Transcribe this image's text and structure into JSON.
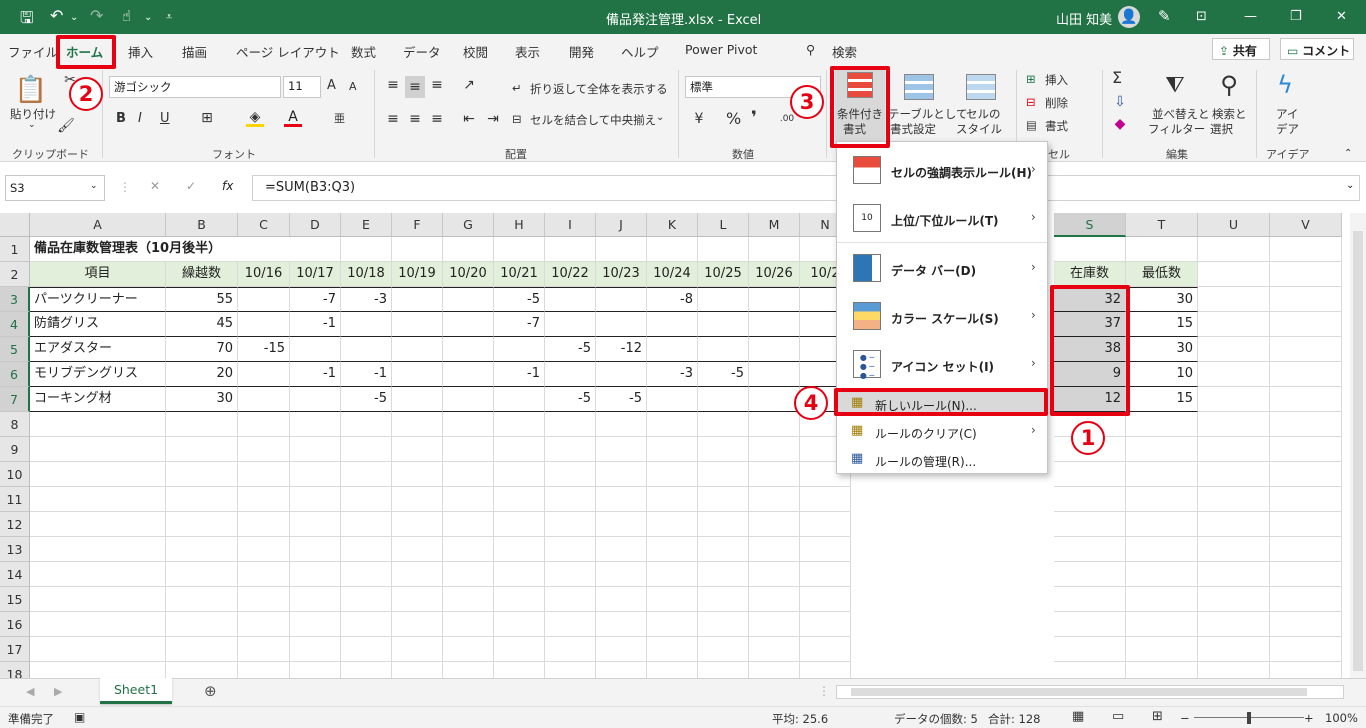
{
  "titlebar": {
    "title": "備品発注管理.xlsx - Excel",
    "user": "山田 知美",
    "qat_save_icon": "save-icon",
    "qat_undo_icon": "undo-icon",
    "qat_redo_icon": "redo-icon",
    "qat_touch_icon": "touch-mode-icon",
    "qat_customize_icon": "customize-qat-icon"
  },
  "tabs": [
    "ファイル",
    "ホーム",
    "挿入",
    "描画",
    "ページ レイアウト",
    "数式",
    "データ",
    "校閲",
    "表示",
    "開発",
    "ヘルプ",
    "Power Pivot"
  ],
  "search_label": "検索",
  "share_label": "共有",
  "comment_label": "コメント",
  "ribbon": {
    "paste_label": "貼り付け",
    "paste_sub": "⌄",
    "clipboard_group": "クリップボード",
    "font_name": "游ゴシック",
    "font_size": "11",
    "font_group": "フォント",
    "bold": "B",
    "italic": "I",
    "underline": "U",
    "font_grow": "A",
    "font_shrink": "A",
    "phonetic": "亜",
    "wrap_text": "折り返して全体を表示する",
    "merge_center": "セルを結合して中央揃え",
    "alignment_group": "配置",
    "number_format": "標準",
    "percent": "%",
    "comma": "❜",
    "number_group": "数値",
    "cond_format_l1": "条件付き",
    "cond_format_l2": "書式",
    "table_format_l1": "テーブルとして",
    "table_format_l2": "書式設定",
    "cell_style_l1": "セルの",
    "cell_style_l2": "スタイル",
    "insert": "挿入",
    "delete": "削除",
    "format": "書式",
    "cells_group": "セル",
    "sum_symbol": "Σ",
    "sort_filter_l1": "並べ替えと",
    "sort_filter_l2": "フィルター",
    "find_select_l1": "検索と",
    "find_select_l2": "選択",
    "editing_group": "編集",
    "ideas_l1": "アイ",
    "ideas_l2": "デア",
    "ideas_group": "アイデア"
  },
  "formula_bar": {
    "name_box": "S3",
    "cancel": "✕",
    "enter": "✓",
    "fx": "fx",
    "formula": "=SUM(B3:Q3)"
  },
  "columns": [
    "A",
    "B",
    "C",
    "D",
    "E",
    "F",
    "G",
    "H",
    "I",
    "J",
    "K",
    "L",
    "M",
    "N",
    "S",
    "T",
    "U",
    "V"
  ],
  "rows": [
    "1",
    "2",
    "3",
    "4",
    "5",
    "6",
    "7",
    "8",
    "9",
    "10",
    "11",
    "12",
    "13",
    "14",
    "15",
    "16",
    "17",
    "18"
  ],
  "sheet": {
    "title": "備品在庫数管理表（10月後半）",
    "headers": {
      "item": "項目",
      "carry": "繰越数",
      "dates": [
        "10/16",
        "10/17",
        "10/18",
        "10/19",
        "10/20",
        "10/21",
        "10/22",
        "10/23",
        "10/24",
        "10/25",
        "10/26",
        "10/2"
      ],
      "stock": "在庫数",
      "min": "最低数"
    },
    "data": [
      {
        "item": "パーツクリーナー",
        "carry": "55",
        "vals": [
          "",
          "-7",
          "-3",
          "",
          "",
          "-5",
          "",
          "",
          "-8",
          "",
          "",
          ""
        ],
        "stock": "32",
        "min": "30"
      },
      {
        "item": "防錆グリス",
        "carry": "45",
        "vals": [
          "",
          "-1",
          "",
          "",
          "",
          "-7",
          "",
          "",
          "",
          "",
          "",
          ""
        ],
        "stock": "37",
        "min": "15"
      },
      {
        "item": "エアダスター",
        "carry": "70",
        "vals": [
          "-15",
          "",
          "",
          "",
          "",
          "",
          "-5",
          "-12",
          "",
          "",
          "",
          ""
        ],
        "stock": "38",
        "min": "30"
      },
      {
        "item": "モリブデングリス",
        "carry": "20",
        "vals": [
          "",
          "-1",
          "-1",
          "",
          "",
          "-1",
          "",
          "",
          "-3",
          "-5",
          "",
          ""
        ],
        "stock": "9",
        "min": "10"
      },
      {
        "item": "コーキング材",
        "carry": "30",
        "vals": [
          "",
          "",
          "-5",
          "",
          "",
          "",
          "-5",
          "-5",
          "",
          "",
          "",
          ""
        ],
        "stock": "12",
        "min": "15"
      }
    ]
  },
  "menu": {
    "items": [
      {
        "label": "セルの強調表示ルール(H)",
        "icon": "highlight-rules-icon",
        "sub": true
      },
      {
        "label": "上位/下位ルール(T)",
        "icon": "top-bottom-rules-icon",
        "sub": true
      },
      {
        "label": "データ バー(D)",
        "icon": "data-bars-icon",
        "sub": true
      },
      {
        "label": "カラー スケール(S)",
        "icon": "color-scales-icon",
        "sub": true
      },
      {
        "label": "アイコン セット(I)",
        "icon": "icon-sets-icon",
        "sub": true
      },
      {
        "label": "新しいルール(N)...",
        "icon": "new-rule-icon",
        "sub": false
      },
      {
        "label": "ルールのクリア(C)",
        "icon": "clear-rules-icon",
        "sub": true
      },
      {
        "label": "ルールの管理(R)...",
        "icon": "manage-rules-icon",
        "sub": false
      }
    ]
  },
  "annotations": {
    "b1": "1",
    "b2": "2",
    "b3": "3",
    "b4": "4"
  },
  "sheet_tab": "Sheet1",
  "status": {
    "ready": "準備完了",
    "average": "平均: 25.6",
    "count": "データの個数: 5",
    "sum": "合計: 128",
    "zoom": "100%",
    "zoom_minus": "−",
    "zoom_plus": "+"
  },
  "colors": {
    "excel_green": "#217346",
    "annotation_red": "#e60012",
    "header_fill": "#e2efda",
    "selection_gray": "#d4d4d4"
  }
}
